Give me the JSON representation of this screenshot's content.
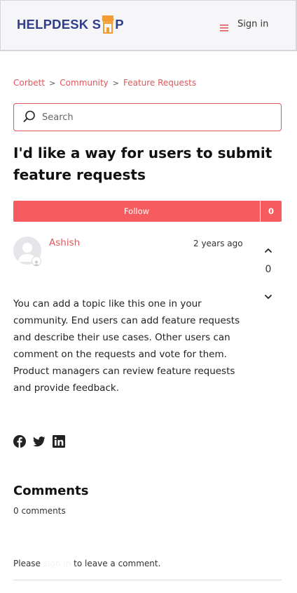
{
  "header": {
    "logo_text_left": "HELPDESK S",
    "logo_text_right": "P",
    "sign_in_label": "Sign in"
  },
  "breadcrumb": [
    "Corbett",
    "Community",
    "Feature Requests"
  ],
  "search": {
    "placeholder": "Search",
    "value": ""
  },
  "post": {
    "title": "I'd like a way for users to submit feature requests",
    "follow_label": "Follow",
    "follow_count": "0",
    "author": "Ashish",
    "timestamp": "2 years ago",
    "vote_count": "0",
    "body": "You can add a topic like this one in your community. End users can add feature requests and describe their use cases. Other users can comment on the requests and vote for them. Product managers can review feature requests and provide feedback."
  },
  "share": {
    "icons": [
      "facebook-icon",
      "twitter-icon",
      "linkedin-icon"
    ]
  },
  "comments": {
    "heading": "Comments",
    "count_text": "0 comments",
    "please_text": "Please",
    "sign_in_link": "sign in",
    "leave_text": "to leave a comment."
  },
  "colors": {
    "accent": "#e0565a",
    "follow_button": "#f55b5f",
    "logo_blue": "#2f3f8c",
    "logo_orange": "#f39c34"
  }
}
